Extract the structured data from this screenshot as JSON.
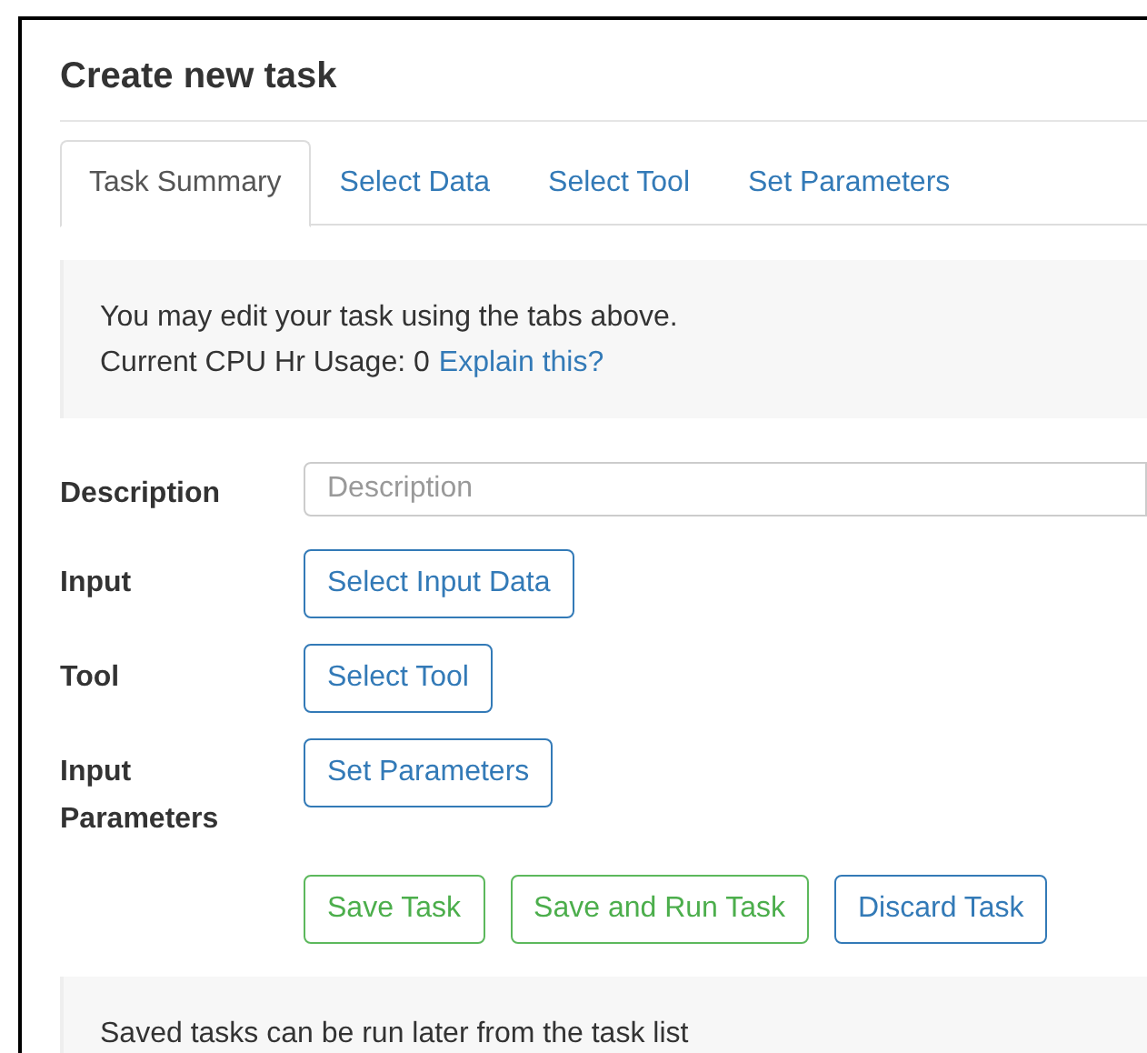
{
  "title": "Create new task",
  "tabs": [
    {
      "label": "Task Summary",
      "selected": true
    },
    {
      "label": "Select Data",
      "selected": false
    },
    {
      "label": "Select Tool",
      "selected": false
    },
    {
      "label": "Set Parameters",
      "selected": false
    }
  ],
  "info": {
    "line_1": "You may edit your task using the tabs above.",
    "line_2": "Current CPU Hr Usage: 0",
    "link": "Explain this?"
  },
  "form": {
    "description": {
      "label": "Description",
      "placeholder": "Description"
    },
    "rows": [
      {
        "label": "Input",
        "button": "Select Input Data"
      },
      {
        "label": "Tool",
        "button": "Select Tool"
      },
      {
        "label": "Input Parameters",
        "button": "Set Parameters"
      }
    ]
  },
  "actions": [
    {
      "label": "Save Task",
      "kind": "success"
    },
    {
      "label": "Save and Run Task",
      "kind": "success"
    },
    {
      "label": "Discard Task",
      "kind": "primary"
    }
  ],
  "note": "Saved tasks can be run later from the task list"
}
